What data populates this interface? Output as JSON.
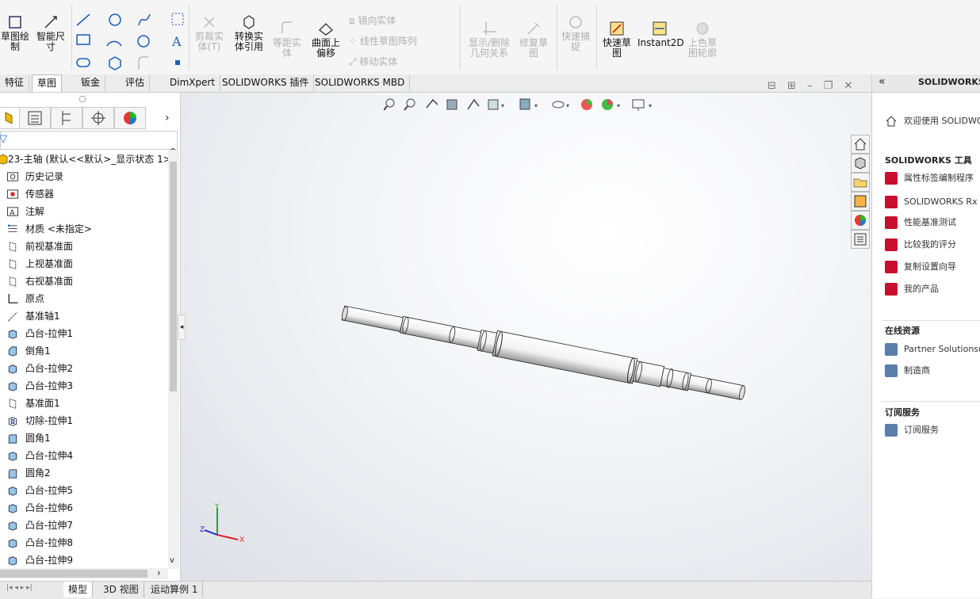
{
  "ribbon": {
    "groups": [
      {
        "label": "草图绘\n制",
        "enabled": true
      },
      {
        "label": "智能尺\n寸",
        "enabled": true
      },
      {
        "label": "剪裁实\n体(T)",
        "enabled": false
      },
      {
        "label": "转换实\n体引用",
        "enabled": true
      },
      {
        "label": "等距实\n体",
        "enabled": false
      },
      {
        "label": "曲面上\n偏移",
        "enabled": true
      },
      {
        "label": "显示/删除\n几何关系",
        "enabled": false
      },
      {
        "label": "修复草\n图",
        "enabled": false
      },
      {
        "label": "快速捕\n捉",
        "enabled": false
      },
      {
        "label": "快速草\n图",
        "enabled": true
      },
      {
        "label": "Instant2D",
        "enabled": true
      },
      {
        "label": "上色草\n图轮廓",
        "enabled": false
      }
    ],
    "small_items": [
      "镜向实体",
      "线性草图阵列",
      "移动实体"
    ]
  },
  "tabs": [
    "特征",
    "草图",
    "钣金",
    "评估",
    "DimXpert",
    "SOLIDWORKS 插件",
    "SOLIDWORKS MBD"
  ],
  "active_tab": "草图",
  "tree": {
    "root": "23-主轴  (默认<<默认>_显示状态 1>",
    "items": [
      {
        "label": "历史记录",
        "icon": "history-icon"
      },
      {
        "label": "传感器",
        "icon": "sensor-icon"
      },
      {
        "label": "注解",
        "icon": "annotation-icon"
      },
      {
        "label": "材质 <未指定>",
        "icon": "material-icon"
      },
      {
        "label": "前视基准面",
        "icon": "plane-icon"
      },
      {
        "label": "上视基准面",
        "icon": "plane-icon"
      },
      {
        "label": "右视基准面",
        "icon": "plane-icon"
      },
      {
        "label": "原点",
        "icon": "origin-icon"
      },
      {
        "label": "基准轴1",
        "icon": "axis-icon"
      },
      {
        "label": "凸台-拉伸1",
        "icon": "extrude-icon"
      },
      {
        "label": "倒角1",
        "icon": "chamfer-icon"
      },
      {
        "label": "凸台-拉伸2",
        "icon": "extrude-icon"
      },
      {
        "label": "凸台-拉伸3",
        "icon": "extrude-icon"
      },
      {
        "label": "基准面1",
        "icon": "plane-icon"
      },
      {
        "label": "切除-拉伸1",
        "icon": "cut-extrude-icon"
      },
      {
        "label": "圆角1",
        "icon": "fillet-icon"
      },
      {
        "label": "凸台-拉伸4",
        "icon": "extrude-icon"
      },
      {
        "label": "圆角2",
        "icon": "fillet-icon"
      },
      {
        "label": "凸台-拉伸5",
        "icon": "extrude-icon"
      },
      {
        "label": "凸台-拉伸6",
        "icon": "extrude-icon"
      },
      {
        "label": "凸台-拉伸7",
        "icon": "extrude-icon"
      },
      {
        "label": "凸台-拉伸8",
        "icon": "extrude-icon"
      },
      {
        "label": "凸台-拉伸9",
        "icon": "extrude-icon"
      }
    ]
  },
  "right_panel": {
    "title": "SOLIDWORKS",
    "welcome": "欢迎使用  SOLIDWO",
    "tools_header": "SOLIDWORKS 工具",
    "tools": [
      "属性标签编制程序",
      "SOLIDWORKS Rx",
      "性能基准测试",
      "比较我的评分",
      "复制设置向导",
      "我的产品"
    ],
    "online_header": "在线资源",
    "online": [
      "Partner Solutions(部",
      "制造商"
    ],
    "subscription_header": "订阅服务",
    "subscription": [
      "订阅服务"
    ]
  },
  "bottom_tabs": [
    "模型",
    "3D 视图",
    "运动算例 1"
  ],
  "triad": {
    "x": "X",
    "y": "Y",
    "z": "Z"
  },
  "colors": {
    "accent": "#c8102e",
    "ribbon_bg": "#f5f5f5",
    "axis_x": "#d22",
    "axis_y": "#2a2",
    "axis_z": "#22c"
  }
}
